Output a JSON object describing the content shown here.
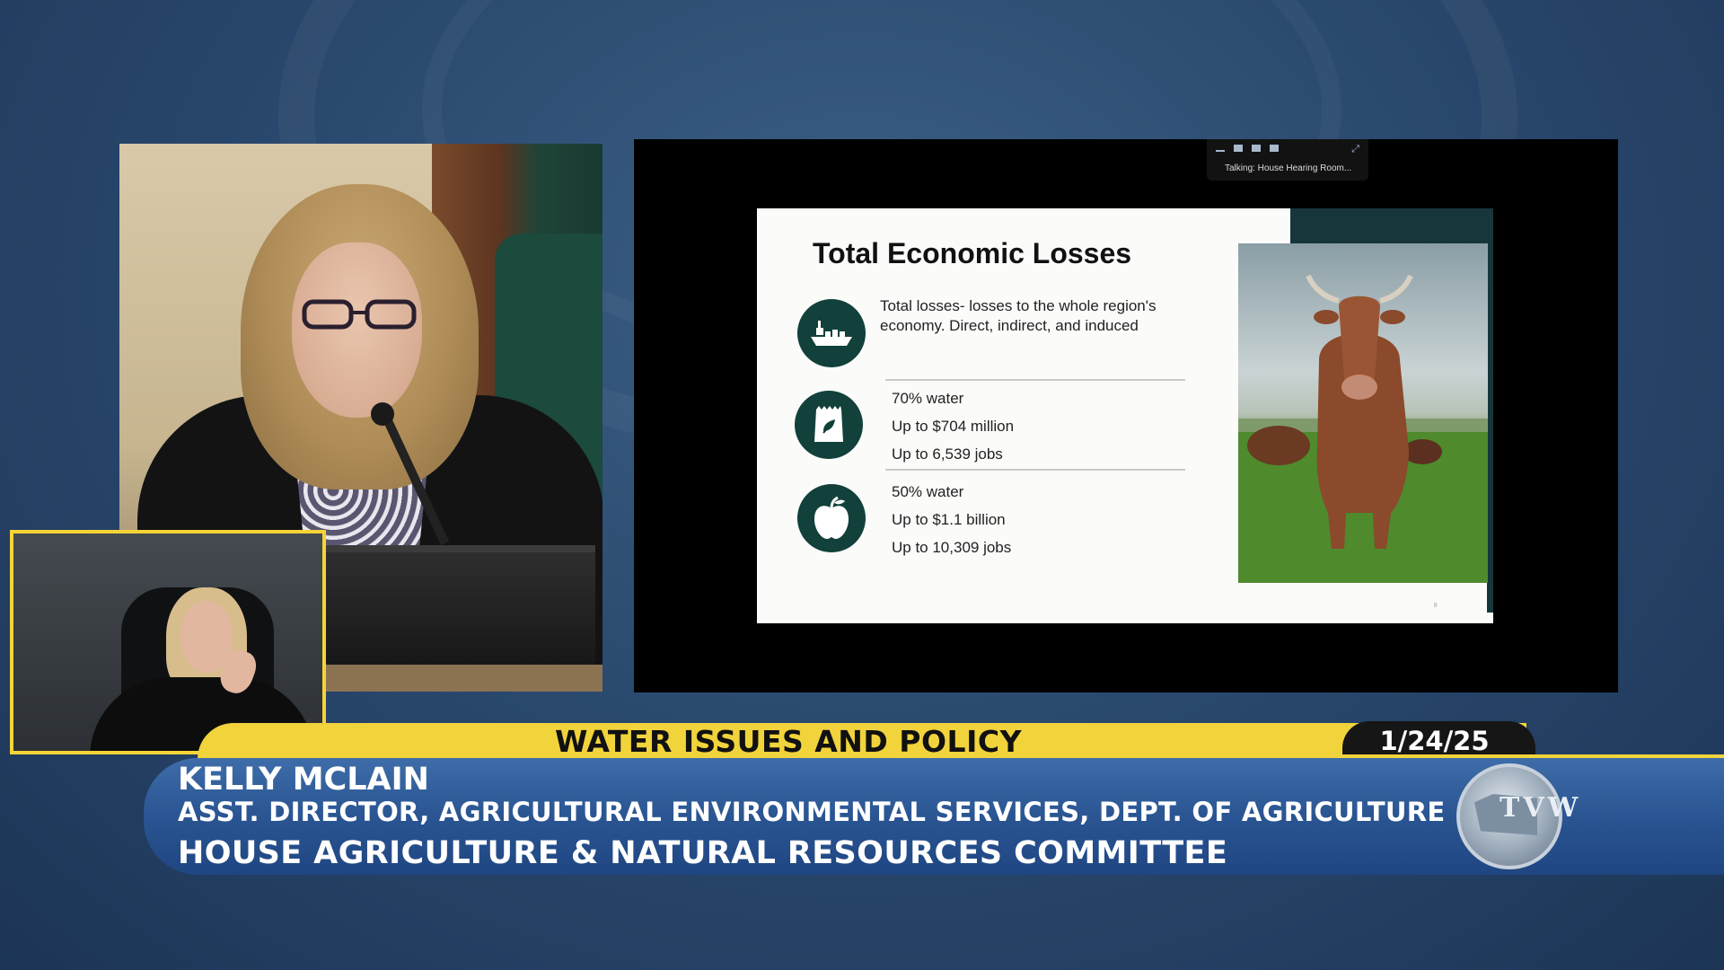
{
  "slide": {
    "title": "Total Economic Losses",
    "intro": "Total losses- losses to the whole region's economy. Direct, indirect, and induced",
    "scenarios": [
      {
        "icon": "fertilizer-bag-icon",
        "water": "70% water",
        "amount": "Up to $704 million",
        "jobs": "Up to 6,539 jobs"
      },
      {
        "icon": "apple-icon",
        "water": "50% water",
        "amount": "Up to $1.1 billion",
        "jobs": "Up to 10,309 jobs"
      }
    ],
    "page_number": "8",
    "colors": {
      "icon_bg": "#12403a",
      "accent": "#17363c"
    }
  },
  "zoom": {
    "talking": "Talking: House Hearing Room..."
  },
  "lower_third": {
    "topic": "WATER ISSUES AND POLICY",
    "date": "1/24/25",
    "name": "KELLY MCLAIN",
    "title": "ASST. DIRECTOR, AGRICULTURAL ENVIRONMENTAL SERVICES, DEPT. OF AGRICULTURE",
    "committee": "HOUSE AGRICULTURE & NATURAL RESOURCES COMMITTEE",
    "colors": {
      "topic_bar": "#f1d33c",
      "name_bar": "#2a5592"
    }
  },
  "logo": {
    "text": "TVW"
  }
}
